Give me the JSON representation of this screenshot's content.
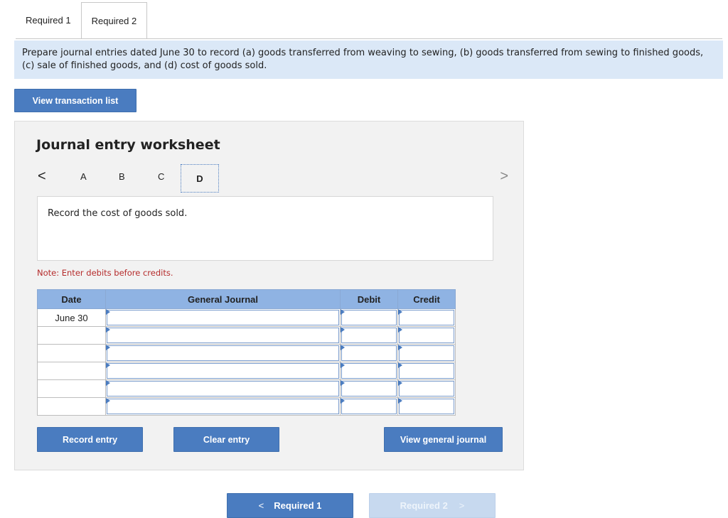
{
  "tabs": [
    {
      "label": "Required 1"
    },
    {
      "label": "Required 2"
    }
  ],
  "instructions": "Prepare journal entries dated June 30 to record (a) goods transferred from weaving to sewing, (b) goods transferred from sewing to finished goods, (c) sale of finished goods, and (d) cost of goods sold.",
  "view_transaction_list_label": "View transaction list",
  "worksheet": {
    "title": "Journal entry worksheet",
    "nav": {
      "prev_glyph": "<",
      "next_glyph": ">",
      "letters": [
        "A",
        "B",
        "C",
        "D"
      ],
      "active": "D"
    },
    "prompt": "Record the cost of goods sold.",
    "note": "Note: Enter debits before credits.",
    "table": {
      "headers": {
        "date": "Date",
        "journal": "General Journal",
        "debit": "Debit",
        "credit": "Credit"
      },
      "rows": [
        {
          "date": "June 30",
          "journal": "",
          "debit": "",
          "credit": ""
        },
        {
          "date": "",
          "journal": "",
          "debit": "",
          "credit": ""
        },
        {
          "date": "",
          "journal": "",
          "debit": "",
          "credit": ""
        },
        {
          "date": "",
          "journal": "",
          "debit": "",
          "credit": ""
        },
        {
          "date": "",
          "journal": "",
          "debit": "",
          "credit": ""
        },
        {
          "date": "",
          "journal": "",
          "debit": "",
          "credit": ""
        }
      ]
    },
    "buttons": {
      "record": "Record entry",
      "clear": "Clear entry",
      "view_journal": "View general journal"
    }
  },
  "bottom_nav": {
    "prev_label": "Required 1",
    "next_label": "Required 2"
  },
  "colors": {
    "accent": "#4a7cc0",
    "instruction_bg": "#dbe8f7",
    "table_header": "#8fb3e3",
    "note": "#b52b2b"
  }
}
